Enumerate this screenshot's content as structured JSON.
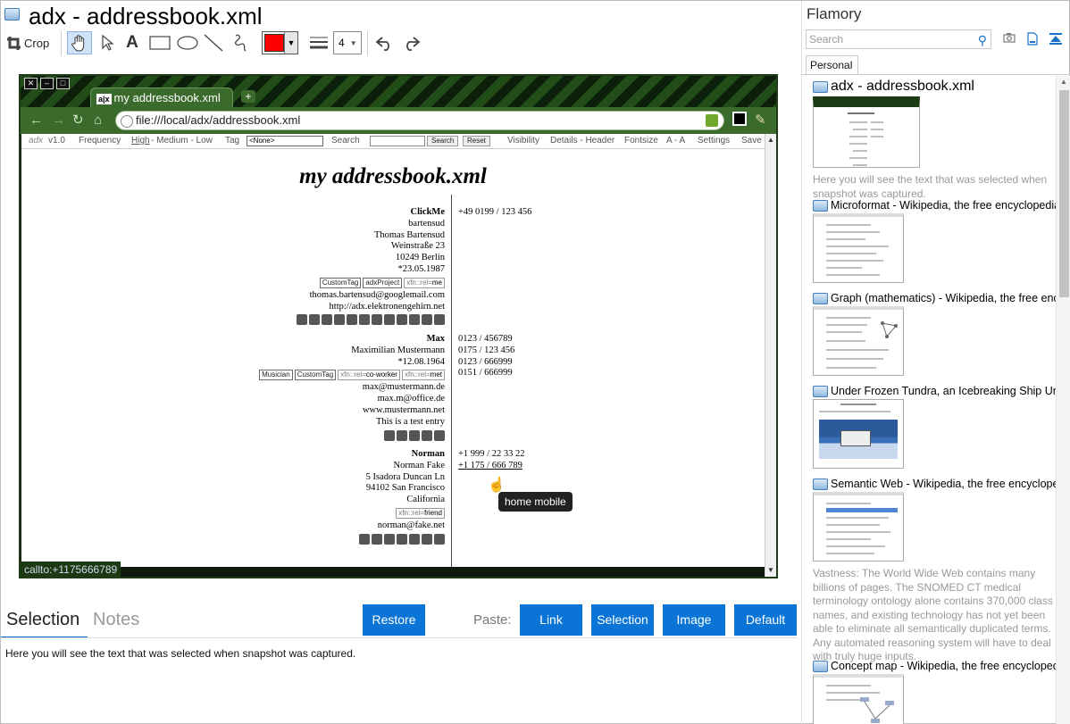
{
  "window": {
    "title": "adx - addressbook.xml"
  },
  "toolbar": {
    "crop_label": "Crop",
    "line_width": "4",
    "color": "#ff0000"
  },
  "snapshot": {
    "tab_title": "my addressbook.xml",
    "tab_favicon": "a|x",
    "url": "file:///local/adx/addressbook.xml",
    "adx_toolbar": {
      "logo": "adx",
      "version": "v1.0",
      "frequency": "Frequency",
      "freq_high": "High",
      "freq_rest": " - Medium - Low",
      "tag": "Tag",
      "tag_select": "<None>",
      "search": "Search",
      "search_btn": "Search",
      "reset_btn": "Reset",
      "visibility": "Visibility",
      "details": "Details - Header",
      "fontsize": "Fontsize",
      "font_ctrl": "A - A",
      "settings": "Settings",
      "save": "Save"
    },
    "heading": "my addressbook.xml",
    "contacts": [
      {
        "name": "ClickMe",
        "lines": [
          "bartensud",
          "Thomas Bartensud",
          "Weinstraße 23",
          "10249 Berlin",
          "*23.05.1987"
        ],
        "tags": [
          "CustomTag",
          "adxProject"
        ],
        "xfn": "me",
        "after": [
          "thomas.bartensud@googlemail.com",
          "http://adx.elektronengehirn.net"
        ],
        "phones": [
          "+49 0199 / 123 456"
        ]
      },
      {
        "name": "Max",
        "lines": [
          "Maximilian Mustermann",
          "*12.08.1964"
        ],
        "tags": [
          "Musician",
          "CustomTag"
        ],
        "xfn": "co-worker",
        "xfn2": "met",
        "after": [
          "max@mustermann.de",
          "max.m@office.de",
          "www.mustermann.net",
          "This is a test entry"
        ],
        "phones": [
          "0123 / 456789",
          "0175 / 123 456",
          "0123 / 666999",
          "0151 / 666999"
        ]
      },
      {
        "name": "Norman",
        "lines": [
          "Norman Fake",
          "5 Isadora Duncan Ln",
          "94102 San Francisco",
          "California"
        ],
        "xfn": "friend",
        "after": [
          "norman@fake.net"
        ],
        "phones": [
          "+1 999 / 22 33 22",
          "+1 175 / 666 789"
        ]
      }
    ],
    "xfn_prefix": "xfn::rel=",
    "tooltip": "home mobile",
    "status": "callto:+1175666789"
  },
  "bottom": {
    "tab_selection": "Selection",
    "tab_notes": "Notes",
    "restore": "Restore",
    "paste_label": "Paste:",
    "paste_link": "Link",
    "paste_selection": "Selection",
    "paste_image": "Image",
    "paste_default": "Default",
    "selection_text": "Here you will see the text that was selected when snapshot was captured."
  },
  "panel": {
    "title": "Flamory",
    "search_placeholder": "Search",
    "tab": "Personal",
    "entries": [
      {
        "title": "adx - addressbook.xml",
        "desc": "Here you will see the text that was selected when snapshot was captured."
      },
      {
        "title": "Microformat - Wikipedia, the free encyclopedia"
      },
      {
        "title": "Graph (mathematics) - Wikipedia, the free ency"
      },
      {
        "title": "Under Frozen Tundra, an Icebreaking Ship Unco"
      },
      {
        "title": "Semantic Web - Wikipedia, the free encycloped",
        "desc": "Vastness: The World Wide Web contains many billions of pages. The SNOMED CT medical terminology ontology alone contains 370,000 class names, and existing technology has not yet been able to eliminate all semantically duplicated terms. Any automated reasoning system will have to deal with truly huge inputs."
      },
      {
        "title": "Concept map - Wikipedia, the free encyclopedia"
      }
    ]
  }
}
